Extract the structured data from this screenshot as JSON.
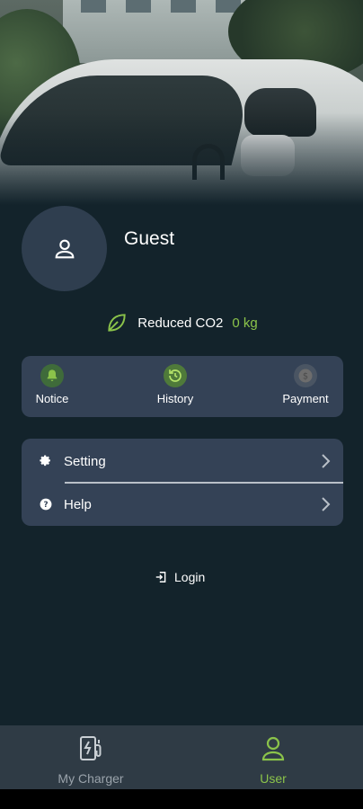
{
  "profile": {
    "name": "Guest",
    "co2_label": "Reduced CO2",
    "co2_value": "0 kg"
  },
  "quick_actions": [
    {
      "label": "Notice",
      "icon": "bell-icon",
      "color": "#6aa84f"
    },
    {
      "label": "History",
      "icon": "history-icon",
      "color": "#7cb342"
    },
    {
      "label": "Payment",
      "icon": "dollar-coin-icon",
      "color": "#6d6d6d"
    }
  ],
  "menu": [
    {
      "label": "Setting",
      "icon": "gear-icon"
    },
    {
      "label": "Help",
      "icon": "help-circle-icon"
    }
  ],
  "login": {
    "label": "Login",
    "icon": "login-icon"
  },
  "bottom_nav": {
    "items": [
      {
        "label": "My Charger",
        "icon": "ev-charger-icon",
        "active": false
      },
      {
        "label": "User",
        "icon": "user-icon",
        "active": true
      }
    ],
    "active_color": "#8bc34a",
    "inactive_color": "#9aa3ab"
  },
  "colors": {
    "background": "#13232b",
    "card": "#344256",
    "accent_green": "#8bc34a"
  }
}
